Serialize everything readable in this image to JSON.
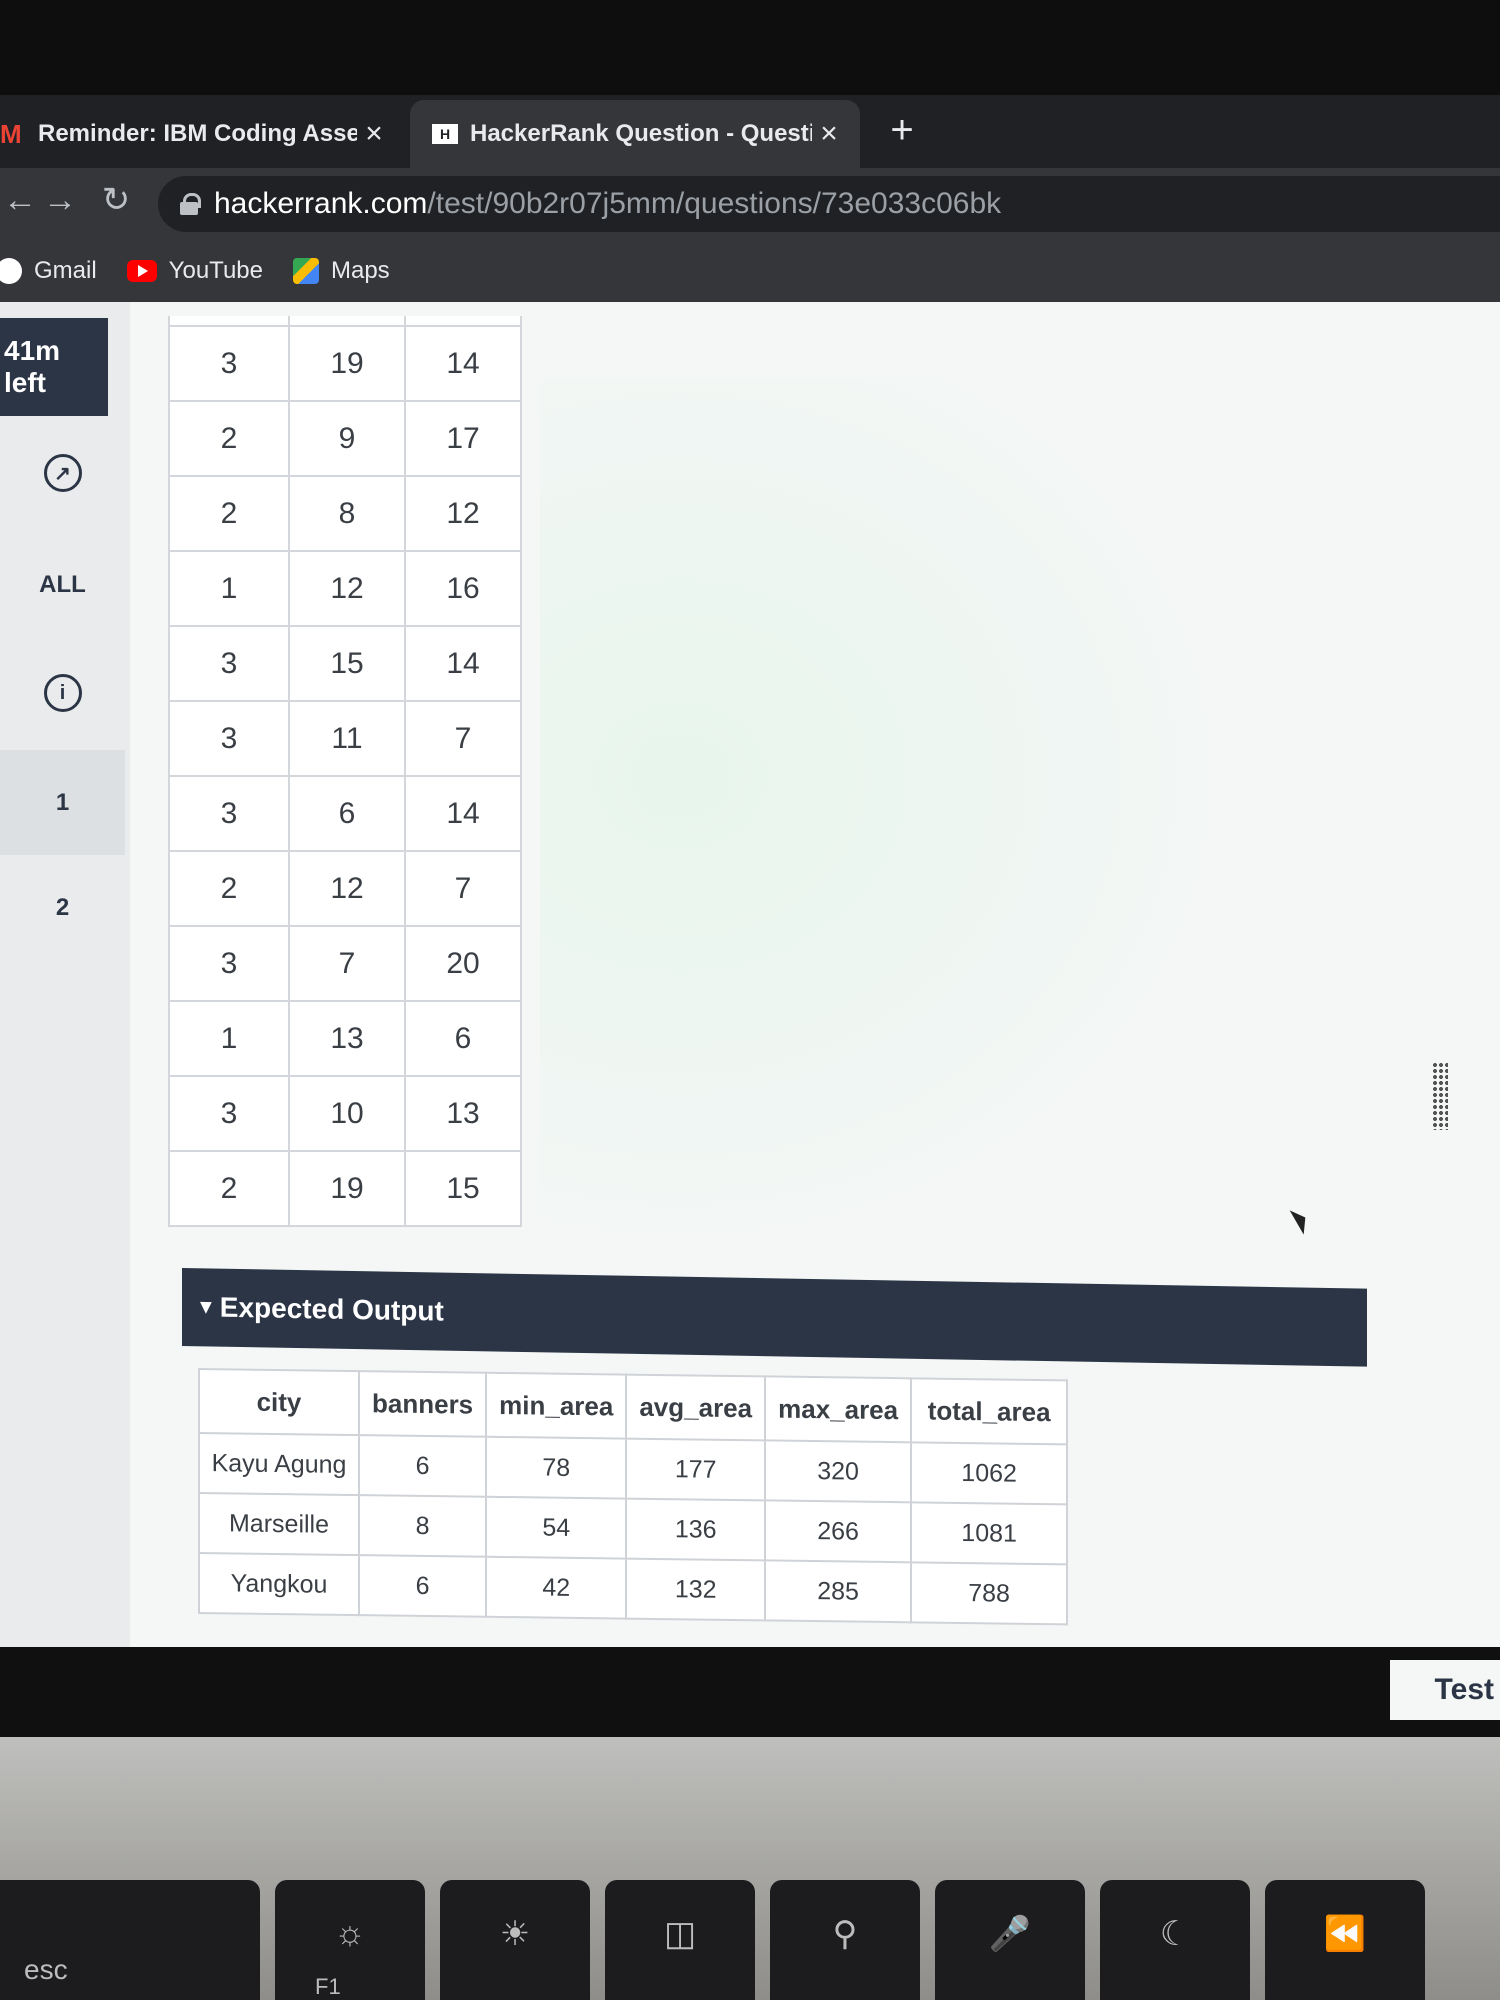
{
  "browser": {
    "tabs": [
      {
        "label": "Reminder: IBM Coding Assess",
        "active": false,
        "icon": "gmail-icon"
      },
      {
        "label": "HackerRank Question - Questi",
        "active": true,
        "icon": "hackerrank-icon"
      }
    ],
    "close_glyph": "×",
    "new_tab_glyph": "+",
    "url_host": "hackerrank.com",
    "url_path": "/test/90b2r07j5mm/questions/73e033c06bk",
    "bookmarks": [
      {
        "label": "Gmail",
        "icon": "google-icon"
      },
      {
        "label": "YouTube",
        "icon": "youtube-icon"
      },
      {
        "label": "Maps",
        "icon": "maps-icon"
      }
    ]
  },
  "sidebar": {
    "timer": "41m left",
    "all_label": "ALL",
    "questions": [
      "1",
      "2"
    ]
  },
  "input_table": [
    [
      "3",
      "19",
      "14"
    ],
    [
      "2",
      "9",
      "17"
    ],
    [
      "2",
      "8",
      "12"
    ],
    [
      "1",
      "12",
      "16"
    ],
    [
      "3",
      "15",
      "14"
    ],
    [
      "3",
      "11",
      "7"
    ],
    [
      "3",
      "6",
      "14"
    ],
    [
      "2",
      "12",
      "7"
    ],
    [
      "3",
      "7",
      "20"
    ],
    [
      "1",
      "13",
      "6"
    ],
    [
      "3",
      "10",
      "13"
    ],
    [
      "2",
      "19",
      "15"
    ]
  ],
  "expected_output": {
    "title": "Expected Output",
    "columns": [
      "city",
      "banners",
      "min_area",
      "avg_area",
      "max_area",
      "total_area"
    ],
    "rows": [
      [
        "Kayu Agung",
        "6",
        "78",
        "177",
        "320",
        "1062"
      ],
      [
        "Marseille",
        "8",
        "54",
        "136",
        "266",
        "1081"
      ],
      [
        "Yangkou",
        "6",
        "42",
        "132",
        "285",
        "788"
      ]
    ]
  },
  "test_button": "Test",
  "keyboard": {
    "esc": "esc",
    "f1": "F1"
  },
  "colors": {
    "header_dark": "#2b3545",
    "page_bg": "#f4f7f6"
  }
}
